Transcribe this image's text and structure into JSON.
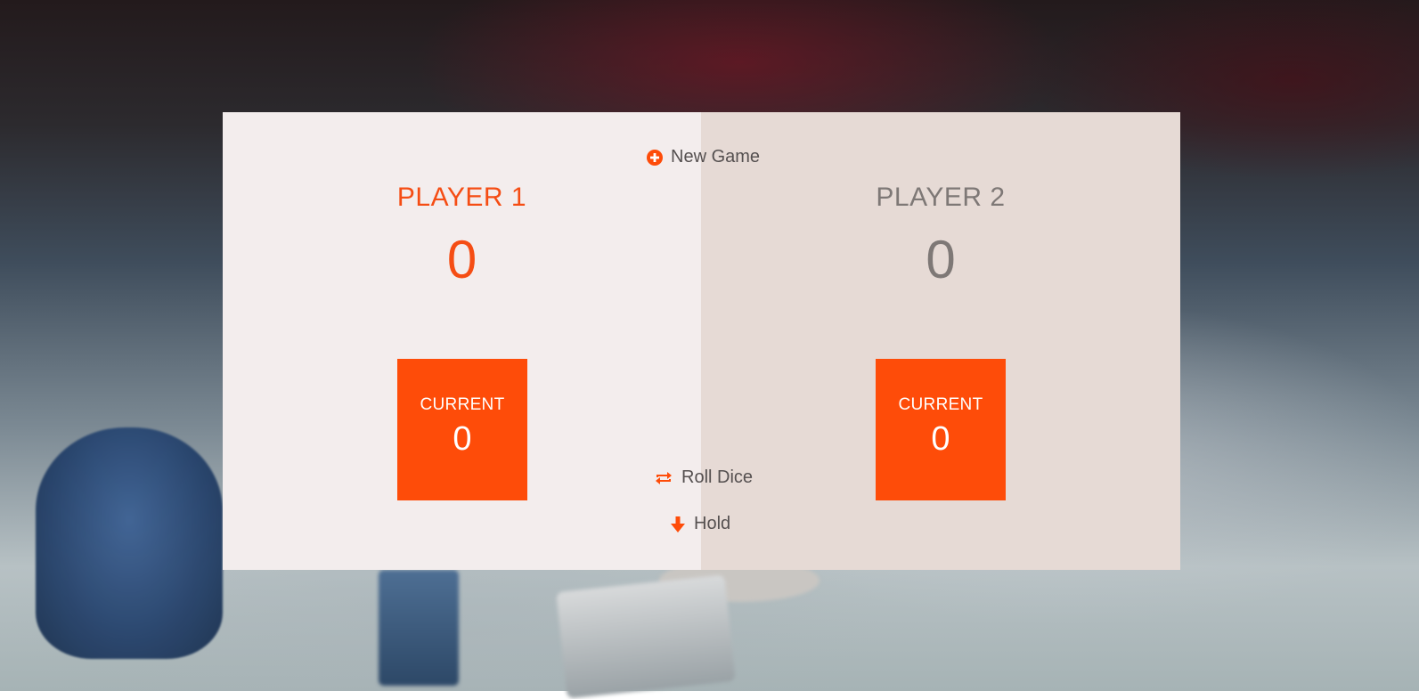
{
  "buttons": {
    "new_game": "New Game",
    "roll_dice": "Roll Dice",
    "hold": "Hold"
  },
  "players": [
    {
      "name": "PLAYER 1",
      "score": "0",
      "current_label": "CURRENT",
      "current": "0",
      "active": true
    },
    {
      "name": "PLAYER 2",
      "score": "0",
      "current_label": "CURRENT",
      "current": "0",
      "active": false
    }
  ],
  "colors": {
    "accent": "#fe4c09",
    "active_panel": "#f3eded",
    "inactive_panel": "#e6dad5",
    "inactive_text": "#7e7876"
  },
  "icons": {
    "new_game": "plus-circle-icon",
    "roll_dice": "refresh-icon",
    "hold": "arrow-down-icon"
  }
}
